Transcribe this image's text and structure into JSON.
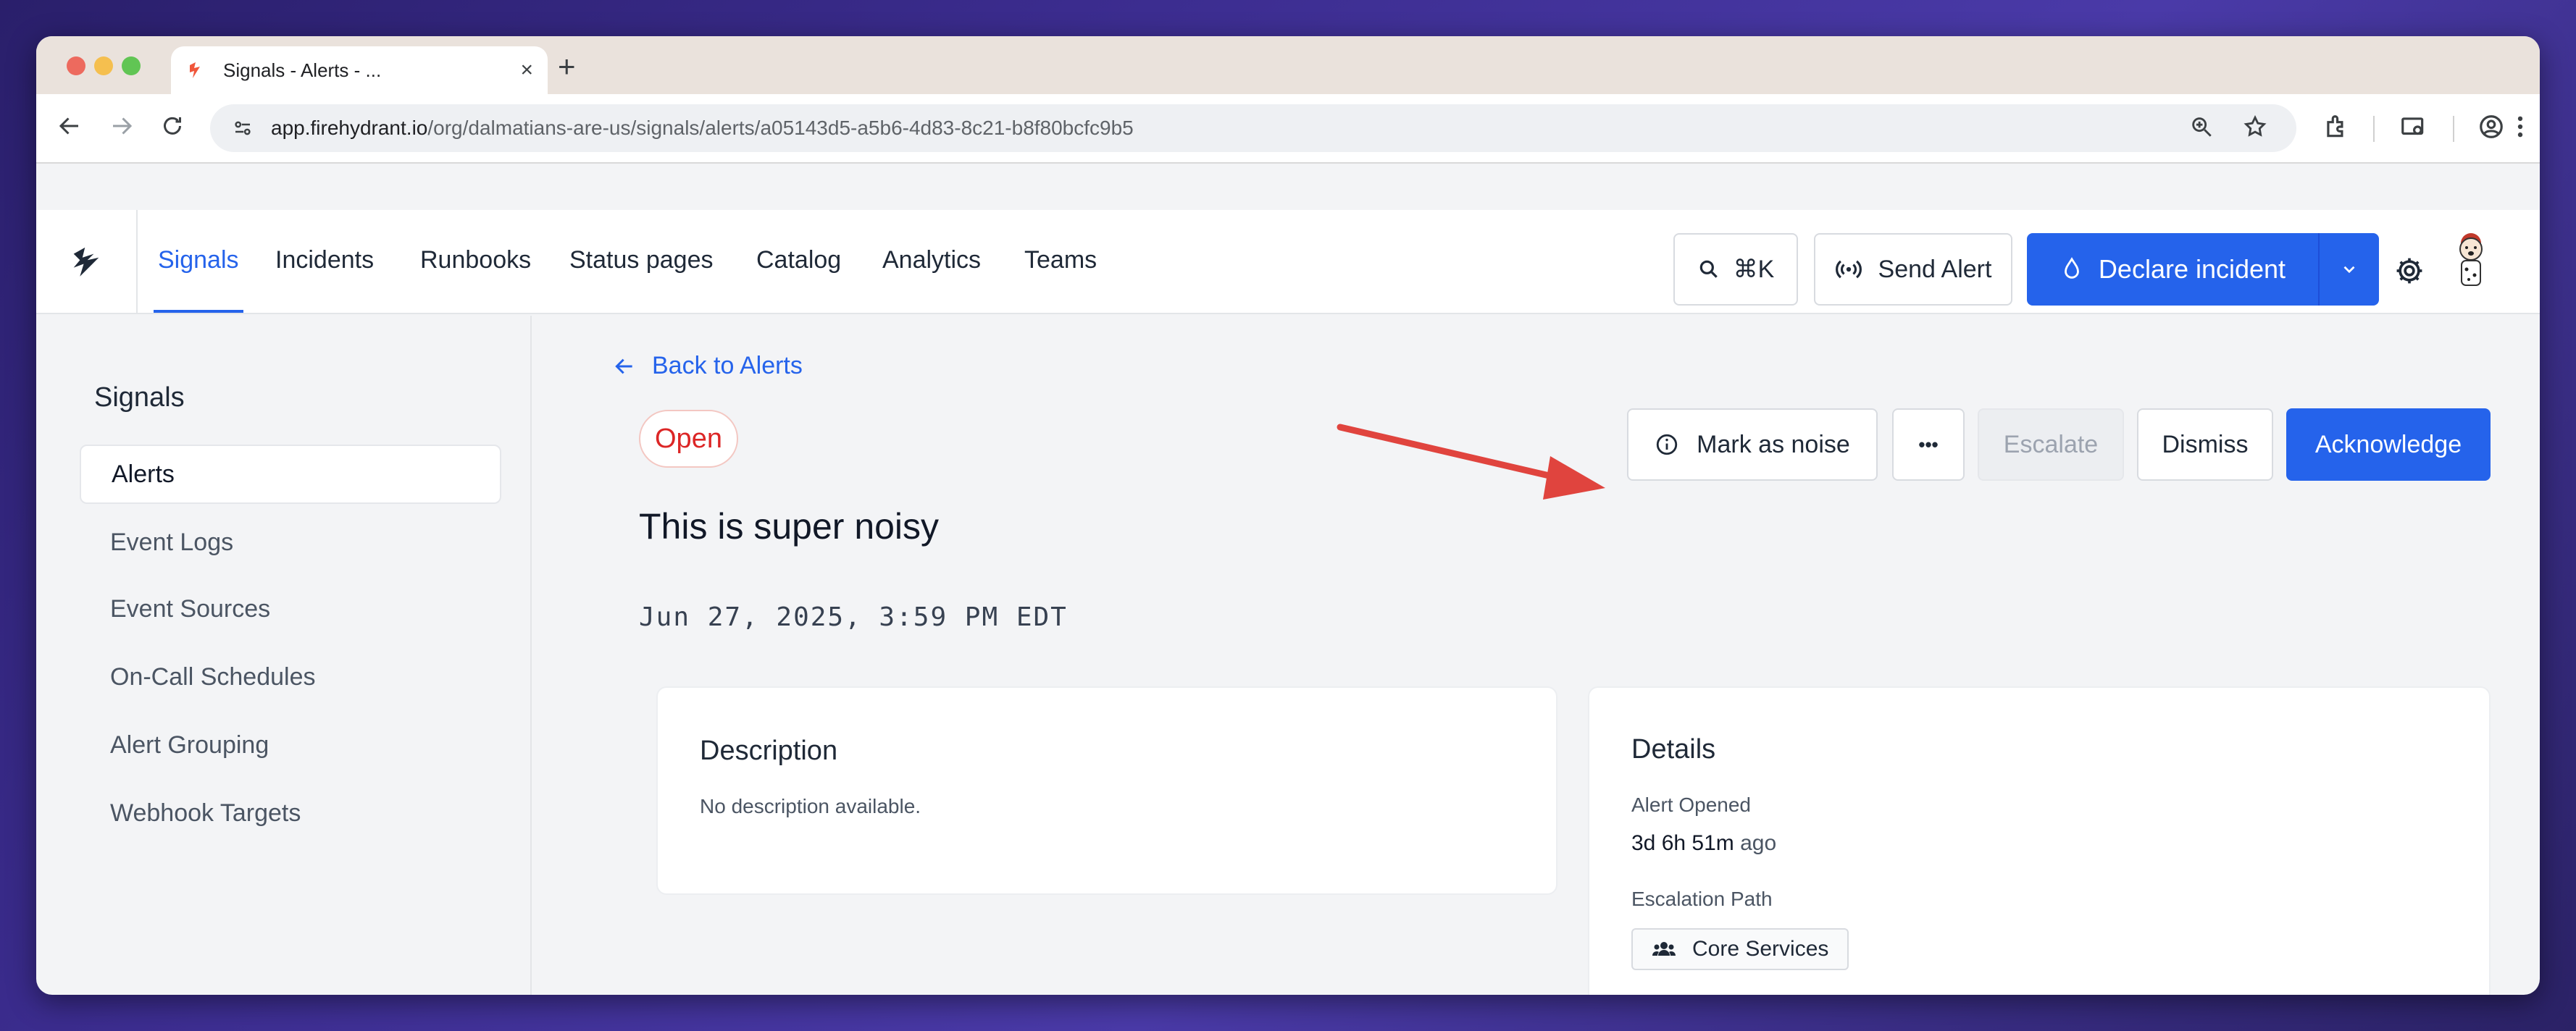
{
  "browser": {
    "tab_title": "Signals - Alerts - ...",
    "new_tab": "+",
    "url_host": "app.firehydrant.io",
    "url_path": "/org/dalmatians-are-us/signals/alerts/a05143d5-a5b6-4d83-8c21-b8f80bcfc9b5"
  },
  "nav": {
    "items": [
      "Signals",
      "Incidents",
      "Runbooks",
      "Status pages",
      "Catalog",
      "Analytics",
      "Teams"
    ],
    "search_shortcut": "⌘K",
    "send_alert": "Send Alert",
    "declare_incident": "Declare incident"
  },
  "sidebar": {
    "heading": "Signals",
    "items": [
      "Alerts",
      "Event Logs",
      "Event Sources",
      "On-Call Schedules",
      "Alert Grouping",
      "Webhook Targets"
    ]
  },
  "alert": {
    "back_link": "Back to Alerts",
    "status": "Open",
    "title": "This is super noisy",
    "timestamp": "Jun 27, 2025, 3:59 PM EDT",
    "actions": {
      "mark_noise": "Mark as noise",
      "more": "•••",
      "escalate": "Escalate",
      "dismiss": "Dismiss",
      "acknowledge": "Acknowledge"
    }
  },
  "description_card": {
    "heading": "Description",
    "text": "No description available."
  },
  "details_card": {
    "heading": "Details",
    "opened_label": "Alert Opened",
    "opened_value": "3d 6h 51m",
    "opened_suffix": "ago",
    "escalation_label": "Escalation Path",
    "escalation_value": "Core Services"
  },
  "colors": {
    "primary": "#2563eb",
    "status_open": "#dc2626",
    "annotation_arrow": "#e0443e"
  }
}
